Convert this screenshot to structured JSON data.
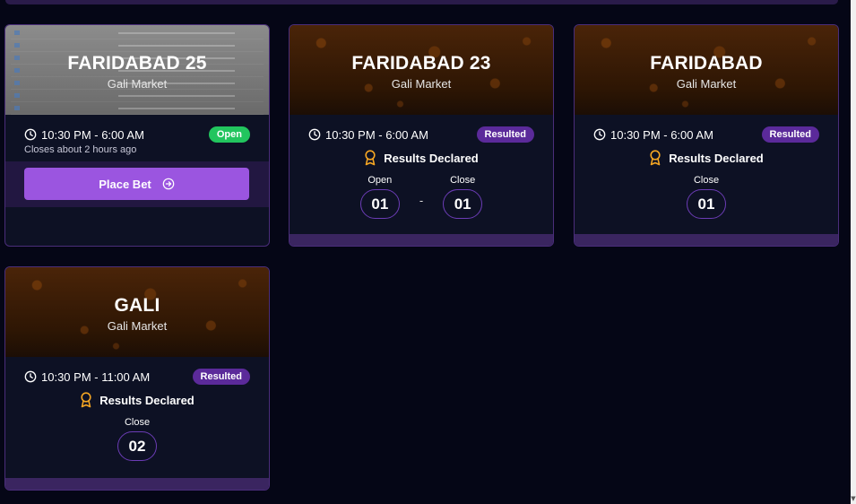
{
  "cards": [
    {
      "title": "FARIDABAD 25",
      "subtitle": "Gali Market",
      "time": "10:30 PM - 6:00 AM",
      "status": "Open",
      "closes_note": "Closes about 2 hours ago",
      "button_label": "Place Bet"
    },
    {
      "title": "FARIDABAD 23",
      "subtitle": "Gali Market",
      "time": "10:30 PM - 6:00 AM",
      "status": "Resulted",
      "declared": "Results Declared",
      "results": [
        {
          "label": "Open",
          "value": "01"
        },
        {
          "label": "Close",
          "value": "01"
        }
      ],
      "separator": "-"
    },
    {
      "title": "FARIDABAD",
      "subtitle": "Gali Market",
      "time": "10:30 PM - 6:00 AM",
      "status": "Resulted",
      "declared": "Results Declared",
      "results": [
        {
          "label": "Close",
          "value": "01"
        }
      ]
    },
    {
      "title": "GALI",
      "subtitle": "Gali Market",
      "time": "10:30 PM - 11:00 AM",
      "status": "Resulted",
      "declared": "Results Declared",
      "results": [
        {
          "label": "Close",
          "value": "02"
        }
      ]
    }
  ],
  "icons": {
    "clock": "clock-icon",
    "medal": "medal-icon",
    "arrow": "arrow-right-circle-icon"
  },
  "colors": {
    "open": "#22c55e",
    "resulted": "#5b2a9a",
    "button": "#9b55e0",
    "medal": "#f5a623"
  }
}
